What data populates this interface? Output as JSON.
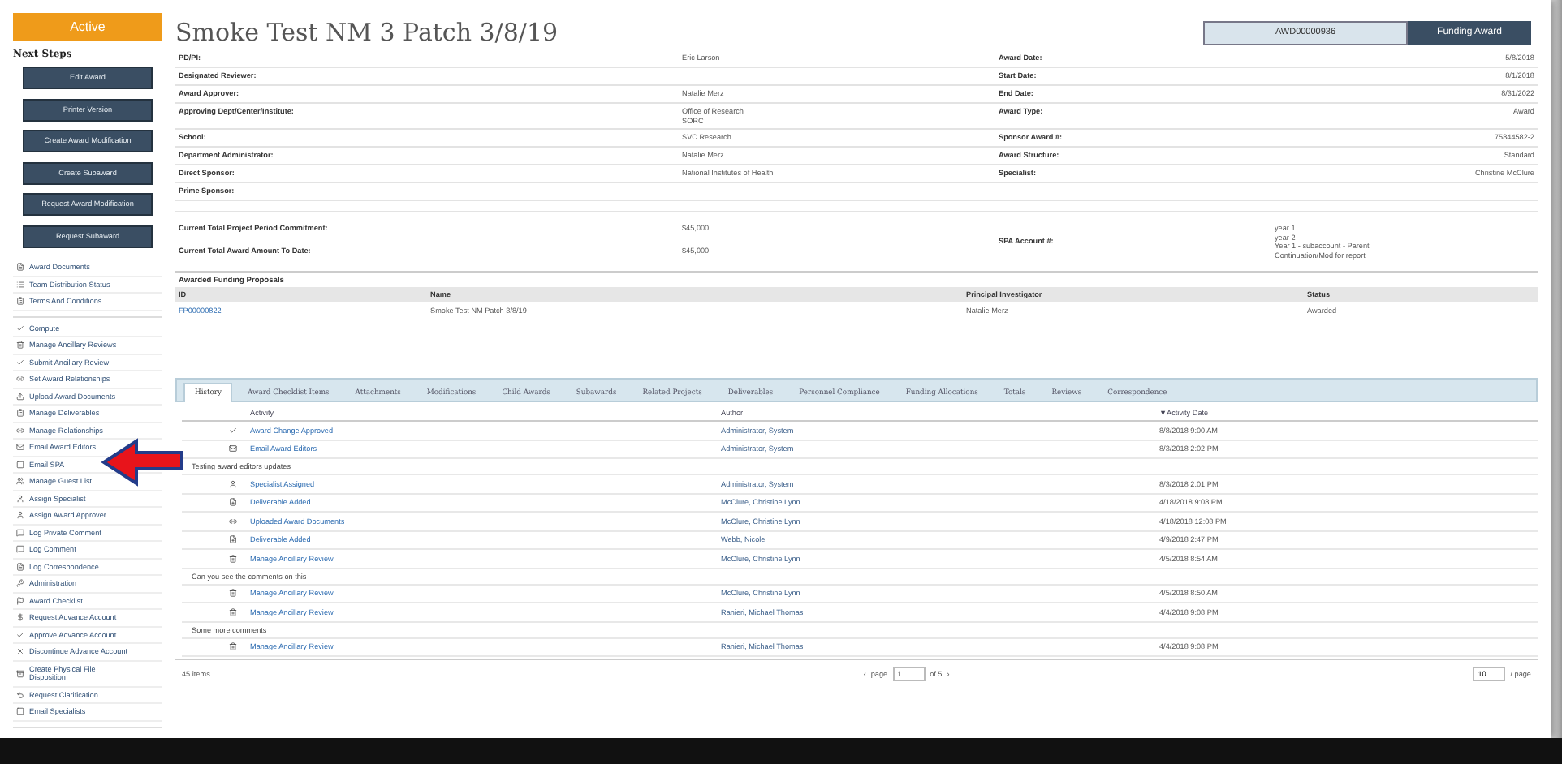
{
  "status_badge": "Active",
  "next_steps": {
    "title": "Next Steps",
    "buttons": [
      "Edit Award",
      "Printer Version",
      "Create Award Modification",
      "Create Subaward",
      "Request Award Modification",
      "Request Subaward"
    ],
    "link_groups": [
      [
        "Award Documents",
        "Team Distribution Status",
        "Terms And Conditions"
      ],
      [
        "Compute",
        "Manage Ancillary Reviews",
        "Submit Ancillary Review",
        "Set Award Relationships",
        "Upload Award Documents",
        "Manage Deliverables",
        "Manage Relationships",
        "Email Award Editors",
        "Email SPA",
        "Manage Guest List",
        "Assign Specialist",
        "Assign Award Approver",
        "Log Private Comment",
        "Log Comment",
        "Log Correspondence",
        "Administration",
        "Award Checklist",
        "Request Advance Account",
        "Approve Advance Account",
        "Discontinue Advance Account",
        "Create Physical File\nDisposition",
        "Request Clarification",
        "Email Specialists"
      ]
    ]
  },
  "title": "Smoke Test NM 3 Patch 3/8/19",
  "record_id": "AWD00000936",
  "record_type": "Funding Award",
  "detail_rows": [
    {
      "left": {
        "label": "PD/PI:",
        "value": "Eric Larson"
      },
      "right": {
        "label": "Award Date:",
        "value": "5/8/2018"
      }
    },
    {
      "left": {
        "label": "Designated Reviewer:"
      },
      "right": {
        "label": "Start Date:",
        "value": "8/1/2018"
      }
    },
    {
      "left": {
        "label": "Award Approver:",
        "value": "Natalie Merz"
      },
      "right": {
        "label": "End Date:",
        "value": "8/31/2022"
      }
    },
    {
      "left": {
        "label": "Approving Dept/Center/Institute:",
        "value": "Office of Research\nSORC"
      },
      "right": {
        "label": "Award Type:",
        "value": "Award"
      }
    },
    {
      "left": {
        "label": "School:",
        "value": "SVC Research"
      },
      "right": {
        "label": "Sponsor Award #:",
        "value": "75844582-2"
      }
    },
    {
      "left": {
        "label": "Department Administrator:",
        "value": "Natalie Merz"
      },
      "right": {
        "label": "Award Structure:",
        "value": "Standard"
      }
    },
    {
      "left": {
        "label": "Direct Sponsor:",
        "value": "National Institutes of Health"
      },
      "right": {
        "label": "Specialist:",
        "value": "Christine McClure"
      }
    },
    {
      "left": {
        "label": "Prime Sponsor:"
      }
    }
  ],
  "totals": {
    "left": [
      {
        "label": "Current Total Project Period Commitment:",
        "value": "$45,000"
      },
      {
        "label": "Current Total Award Amount To Date:",
        "value": "$45,000"
      }
    ],
    "right": {
      "label": "SPA Account #:",
      "value": "year 1\nyear 2\nYear 1 - subaccount - Parent\nContinuation/Mod for report"
    }
  },
  "proposals": {
    "title": "Awarded Funding Proposals",
    "columns": [
      "ID",
      "Name",
      "Principal Investigator",
      "Status"
    ],
    "rows": [
      [
        "FP00000822",
        "Smoke Test NM Patch 3/8/19",
        "Natalie Merz",
        "Awarded"
      ]
    ]
  },
  "tabs": [
    {
      "label": "History",
      "selected": true
    },
    {
      "label": "Award Checklist Items",
      "selected": false
    },
    {
      "label": "Attachments",
      "selected": false
    },
    {
      "label": "Modifications",
      "selected": false
    },
    {
      "label": "Child Awards",
      "selected": false
    },
    {
      "label": "Subawards",
      "selected": false
    },
    {
      "label": "Related Projects",
      "selected": false
    },
    {
      "label": "Deliverables",
      "selected": false
    },
    {
      "label": "Personnel Compliance",
      "selected": false
    },
    {
      "label": "Funding Allocations",
      "selected": false
    },
    {
      "label": "Totals",
      "selected": false
    },
    {
      "label": "Reviews",
      "selected": false
    },
    {
      "label": "Correspondence",
      "selected": false
    }
  ],
  "history": {
    "columns": [
      "Activity",
      "Author",
      "Activity Date"
    ],
    "sort_mark": "▼",
    "rows": [
      {
        "activity": "Award Change Approved",
        "author": "Administrator, System",
        "date": "8/8/2018 9:00 AM"
      },
      {
        "activity": "Email Award Editors",
        "author": "Administrator, System",
        "date": "8/3/2018 2:02 PM",
        "comment": "Testing award editors updates"
      },
      {
        "activity": "Specialist Assigned",
        "author": "Administrator, System",
        "date": "8/3/2018 2:01 PM"
      },
      {
        "activity": "Deliverable Added",
        "author": "McClure, Christine Lynn",
        "date": "4/18/2018 9:08 PM"
      },
      {
        "activity": "Uploaded Award Documents",
        "author": "McClure, Christine Lynn",
        "date": "4/18/2018 12:08 PM"
      },
      {
        "activity": "Deliverable Added",
        "author": "Webb, Nicole",
        "date": "4/9/2018 2:47 PM"
      },
      {
        "activity": "Manage Ancillary Review",
        "author": "McClure, Christine Lynn",
        "date": "4/5/2018 8:54 AM",
        "comment": "Can you see the comments on this"
      },
      {
        "activity": "Manage Ancillary Review",
        "author": "McClure, Christine Lynn",
        "date": "4/5/2018 8:50 AM"
      },
      {
        "activity": "Manage Ancillary Review",
        "author": "Ranieri, Michael Thomas",
        "date": "4/4/2018 9:08 PM",
        "comment": "Some more comments"
      },
      {
        "activity": "Manage Ancillary Review",
        "author": "Ranieri, Michael Thomas",
        "date": "4/4/2018 9:08 PM"
      }
    ],
    "item_count": "45 items",
    "prev": "‹",
    "page_label": "page",
    "page": "1",
    "of_label": "of 5",
    "next": "›",
    "per_page": "10",
    "per_page_label": "/ page"
  }
}
